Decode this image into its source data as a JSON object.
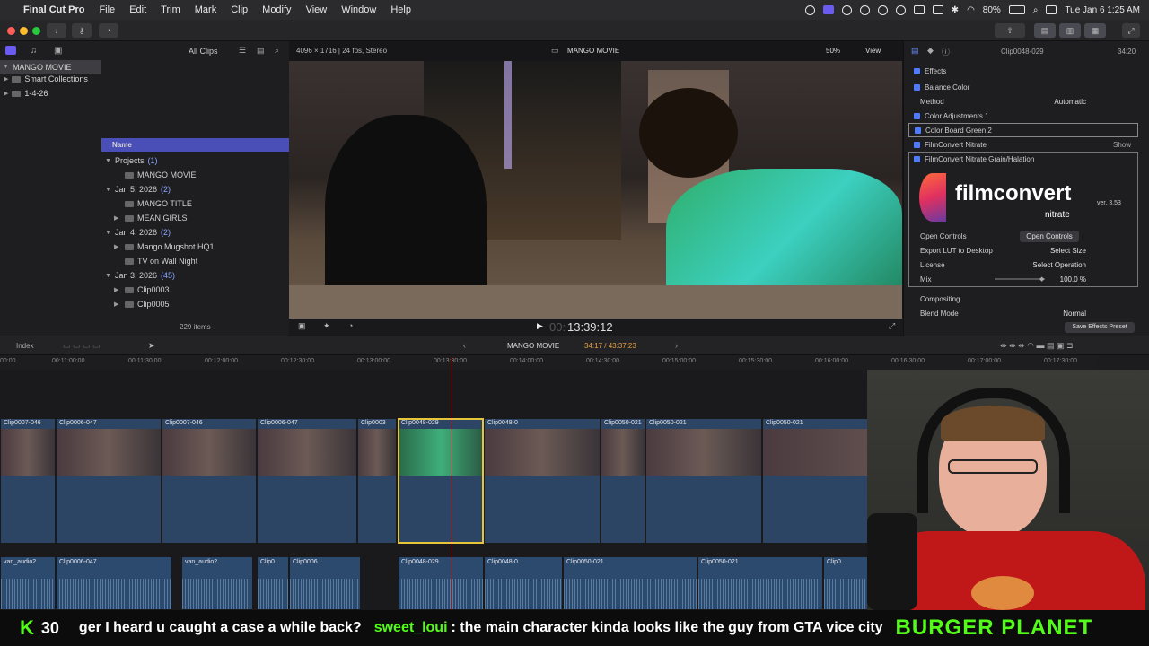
{
  "menubar": {
    "app": "Final Cut Pro",
    "items": [
      "File",
      "Edit",
      "Trim",
      "Mark",
      "Clip",
      "Modify",
      "View",
      "Window",
      "Help"
    ],
    "battery": "80%",
    "datetime": "Tue Jan 6  1:25 AM"
  },
  "browser": {
    "filter": "All Clips",
    "library": "MANGO MOVIE",
    "smart": "Smart Collections",
    "event": "1-4-26",
    "col_name": "Name",
    "rows": [
      {
        "t": "Projects",
        "c": "(1)",
        "kind": "group"
      },
      {
        "t": "MANGO MOVIE",
        "kind": "item"
      },
      {
        "t": "Jan 5, 2026",
        "c": "(2)",
        "kind": "group"
      },
      {
        "t": "MANGO TITLE",
        "kind": "item"
      },
      {
        "t": "MEAN GIRLS",
        "kind": "item2"
      },
      {
        "t": "Jan 4, 2026",
        "c": "(2)",
        "kind": "group"
      },
      {
        "t": "Mango Mugshot HQ1",
        "kind": "item2"
      },
      {
        "t": "TV on Wall Night",
        "kind": "item"
      },
      {
        "t": "Jan 3, 2026",
        "c": "(45)",
        "kind": "group"
      },
      {
        "t": "Clip0003",
        "kind": "item2"
      },
      {
        "t": "Clip0005",
        "kind": "item2"
      }
    ],
    "count": "229 items"
  },
  "viewer": {
    "format": "4096 × 1716 | 24 fps, Stereo",
    "title": "MANGO MOVIE",
    "zoom": "50%",
    "view": "View",
    "timecode": "13:39:12",
    "tc_prefix": "00:"
  },
  "inspector": {
    "clip": "Clip0048-029",
    "duration": "34:20",
    "effects": "Effects",
    "balance": "Balance Color",
    "method_label": "Method",
    "method": "Automatic",
    "adj": "Color Adjustments 1",
    "board": "Color Board Green 2",
    "fc": "FilmConvert Nitrate",
    "fcgrain": "FilmConvert Nitrate Grain/Halation",
    "logo": "filmconvert",
    "logo_sub": "nitrate",
    "version": "ver. 3.53",
    "open_label": "Open Controls",
    "open_btn": "Open Controls",
    "lut_label": "Export LUT to Desktop",
    "lut": "Select Size",
    "lic_label": "License",
    "lic": "Select Operation",
    "mix_label": "Mix",
    "mix": "100.0 %",
    "compositing": "Compositing",
    "blend_label": "Blend Mode",
    "blend": "Normal",
    "save": "Save Effects Preset",
    "show": "Show"
  },
  "timeline": {
    "index": "Index",
    "project": "MANGO MOVIE",
    "pos": "34:17 / 43:37:23",
    "ticks": [
      "00:00",
      "00:11:00:00",
      "00:11:30:00",
      "00:12:00:00",
      "00:12:30:00",
      "00:13:00:00",
      "00:13:30:00",
      "00:14:00:00",
      "00:14:30:00",
      "00:15:00:00",
      "00:15:30:00",
      "00:16:00:00",
      "00:16:30:00",
      "00:17:00:00",
      "00:17:30:00"
    ],
    "clips": [
      "Clip0007-046",
      "Clip0006-047",
      "Clip0007-046",
      "Clip0006-047",
      "Clip0003",
      "Clip0048-029",
      "Clip0048-0",
      "Clip0050-021",
      "Clip0050-021",
      "Clip0050-021"
    ],
    "audio": [
      "van_audio2",
      "Clip0006-047",
      "van_audio2",
      "Clip0...",
      "Clip0006...",
      "Clip0048-029",
      "Clip0048-0...",
      "Clip0050-021",
      "Clip0050-021",
      "Clip0..."
    ]
  },
  "chat": {
    "count": "30",
    "msg1": "ger I heard u caught a case a while back?",
    "user": "sweet_loui",
    "msg2": ": the main character kinda looks like the guy from GTA vice city",
    "brand": "BURGER PLANET"
  }
}
